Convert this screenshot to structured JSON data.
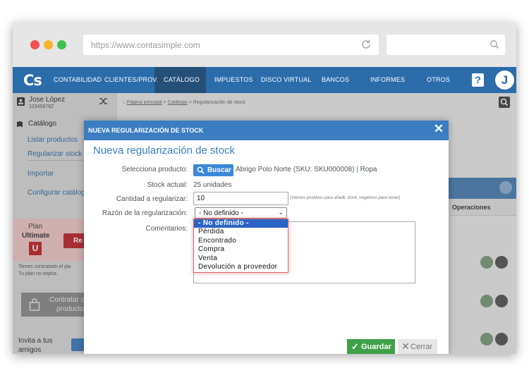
{
  "browser": {
    "url": "https://www.contasimple.com"
  },
  "nav": {
    "logo": "Cs",
    "items": [
      "CONTABILIDAD",
      "CLIENTES/PROV.",
      "CATÁLOGO",
      "IMPUESTOS",
      "DISCO VIRTUAL",
      "BANCOS",
      "INFORMES",
      "OTROS"
    ],
    "help": "?",
    "avatar": "J"
  },
  "user": {
    "name": "Jose López",
    "id": "12345678Z"
  },
  "sidebar": {
    "section": "Catálogo",
    "items": [
      "Listar productos",
      "Regularizar stock",
      "Importar",
      "Configurar catálog"
    ],
    "plan_label": "Plan",
    "plan_name": "Ultimate",
    "plan_badge": "U",
    "plan_button": "Re",
    "plan_note_1": "Tienes contratado el pla",
    "plan_note_2": "Tu plan no expira.",
    "contract_1": "Contratar c",
    "contract_2": "producto",
    "invite_1": "Invita a tus",
    "invite_2": "amigos"
  },
  "breadcrumb": {
    "prefix": ":: ",
    "home": "Página principal",
    "sep": " > ",
    "catalog": "Catálogo",
    "current": " > Regularización de stock"
  },
  "table": {
    "operations_header": "Operaciones"
  },
  "modal": {
    "header": "NUEVA REGULARIZACIÓN DE STOCK",
    "title": "Nueva regularización de stock",
    "close": "✕",
    "fields": {
      "product_label": "Selecciona producto:",
      "search_button": "Buscar",
      "product_value": "Abrigo Polo Norte (SKU: SKU000008)",
      "product_sep": " | ",
      "product_category": "Ropa",
      "stock_label": "Stock actual:",
      "stock_value": "25 unidades",
      "qty_label": "Cantidad a regularizar:",
      "qty_value": "10",
      "qty_hint": "(Valores positivos para añadir stock, negativos para restar)",
      "reason_label": "Razón de la regularización:",
      "reason_selected": "- No definido -",
      "comments_label": "Comentarios:"
    },
    "reason_options": [
      "- No definido -",
      "Pérdida",
      "Encontrado",
      "Compra",
      "Venta",
      "Devolución a proveedor"
    ],
    "save_button": "Guardar",
    "close_button": "Cerrar"
  },
  "colors": {
    "nav": "#2b6cab",
    "modal_header": "#3b7dc0",
    "save": "#3fa04a",
    "selected_option": "#2a64c5",
    "highlight": "#e06468"
  }
}
